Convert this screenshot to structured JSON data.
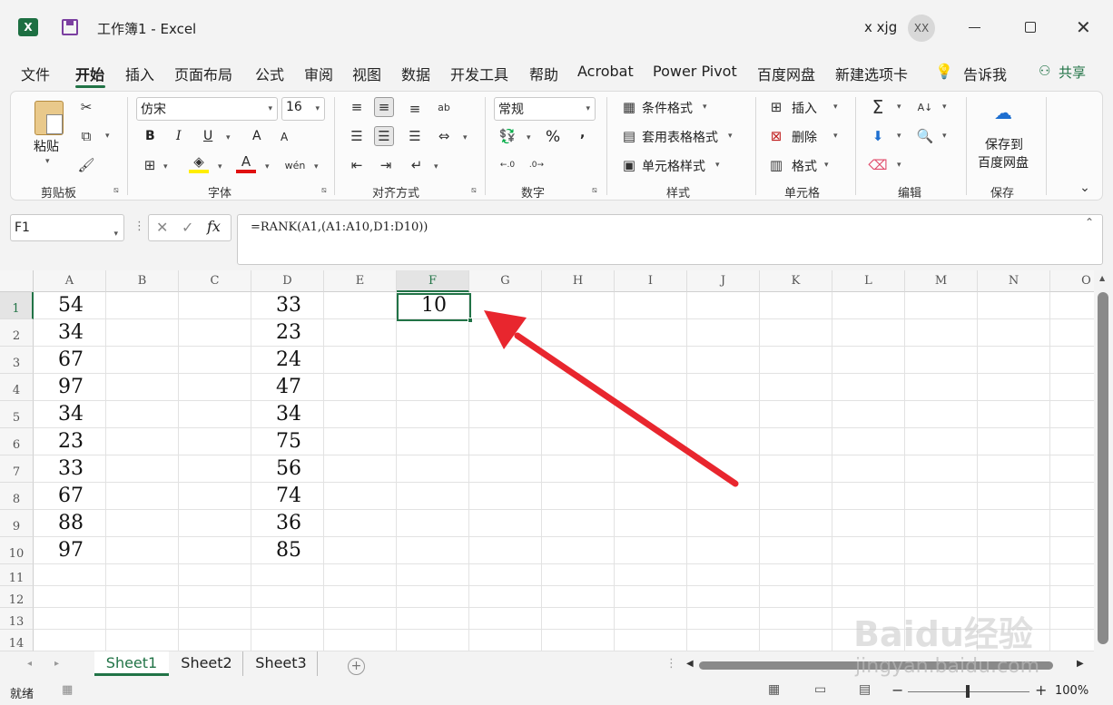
{
  "window": {
    "title": "工作簿1 - Excel",
    "user": "x xjg",
    "avatar_initials": "XX"
  },
  "menu": {
    "items": [
      "文件",
      "开始",
      "插入",
      "页面布局",
      "公式",
      "审阅",
      "视图",
      "数据",
      "开发工具",
      "帮助",
      "Acrobat",
      "Power Pivot",
      "百度网盘",
      "新建选项卡"
    ],
    "tell_me": "告诉我",
    "share": "共享"
  },
  "ribbon": {
    "clipboard": {
      "paste": "粘贴",
      "label": "剪贴板"
    },
    "font": {
      "name": "仿宋",
      "size": "16",
      "bold": "B",
      "italic": "I",
      "underline": "U",
      "increase": "A",
      "decrease": "A",
      "label": "字体"
    },
    "alignment": {
      "label": "对齐方式"
    },
    "number": {
      "format": "常规",
      "percent": "%",
      "comma": ",",
      "label": "数字"
    },
    "styles": {
      "conditional": "条件格式",
      "table": "套用表格格式",
      "cell": "单元格样式",
      "label": "样式"
    },
    "cells": {
      "insert": "插入",
      "delete": "删除",
      "format": "格式",
      "label": "单元格"
    },
    "editing": {
      "label": "编辑"
    },
    "save": {
      "line1": "保存到",
      "line2": "百度网盘",
      "label": "保存"
    }
  },
  "formula_bar": {
    "name_box": "F1",
    "formula": "=RANK(A1,(A1:A10,D1:D10))"
  },
  "sheet": {
    "columns": [
      "A",
      "B",
      "C",
      "D",
      "E",
      "F",
      "G",
      "H",
      "I",
      "J",
      "K",
      "L",
      "M",
      "N",
      "O"
    ],
    "rows": [
      "1",
      "2",
      "3",
      "4",
      "5",
      "6",
      "7",
      "8",
      "9",
      "10",
      "11",
      "12",
      "13",
      "14"
    ],
    "col_a": [
      "54",
      "34",
      "67",
      "97",
      "34",
      "23",
      "33",
      "67",
      "88",
      "97"
    ],
    "col_d": [
      "33",
      "23",
      "24",
      "47",
      "34",
      "75",
      "56",
      "74",
      "36",
      "85"
    ],
    "f1": "10",
    "selected_cell": "F1"
  },
  "tabs": {
    "sheets": [
      "Sheet1",
      "Sheet2",
      "Sheet3"
    ],
    "active": "Sheet1"
  },
  "status": {
    "ready": "就绪",
    "zoom": "100%"
  },
  "watermark": {
    "brand": "Baidu经验",
    "url": "jingyan.baidu.com"
  },
  "colors": {
    "excel_green": "#217346",
    "arrow_red": "#e8262e",
    "accent_blue": "#1e6fd0"
  }
}
